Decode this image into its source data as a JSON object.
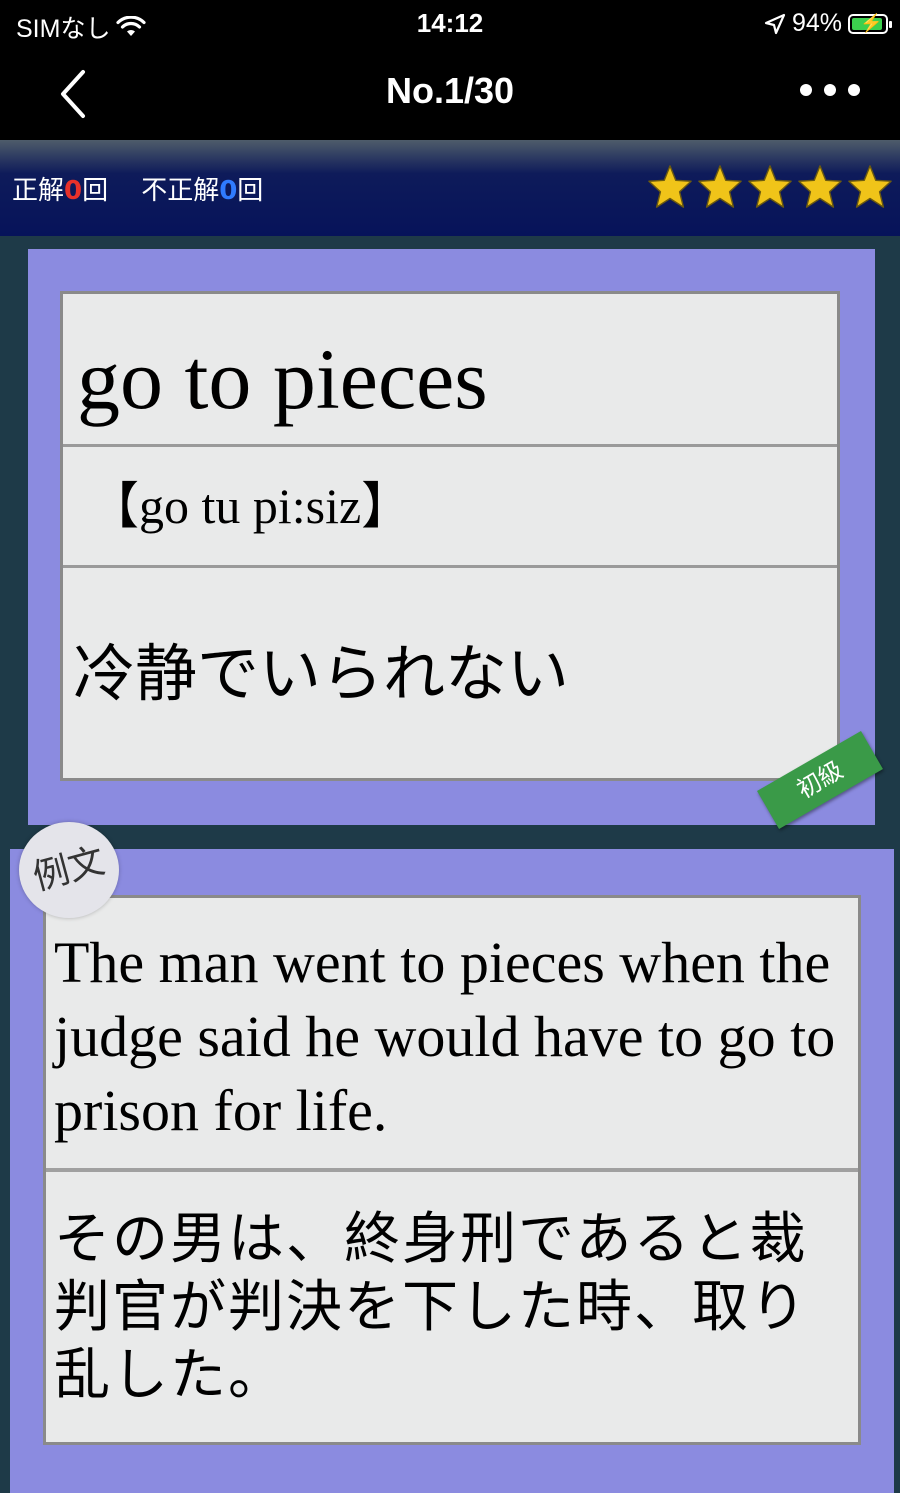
{
  "status_bar": {
    "carrier": "SIMなし",
    "time": "14:12",
    "battery": "94%"
  },
  "nav": {
    "title": "No.1/30"
  },
  "score": {
    "correct_label": "正解",
    "correct_count": "0",
    "correct_suffix": "回",
    "incorrect_label": "不正解",
    "incorrect_count": "0",
    "incorrect_suffix": "回",
    "stars": 5,
    "star_color": "#f0c419"
  },
  "word_card": {
    "phrase": "go to pieces",
    "pronunciation": "【go tu pi:siz】",
    "meaning": "冷静でいられない",
    "level": "初級"
  },
  "example_card": {
    "badge": "例文",
    "english": "The man went to pieces when the judge said he would have to go to prison for life.",
    "japanese": "その男は、終身刑であると裁判官が判決を下した時、取り乱した。"
  },
  "colors": {
    "card_bg": "#8b8be0",
    "inner_bg": "#e9eaea",
    "level_badge": "#3a9a48"
  }
}
